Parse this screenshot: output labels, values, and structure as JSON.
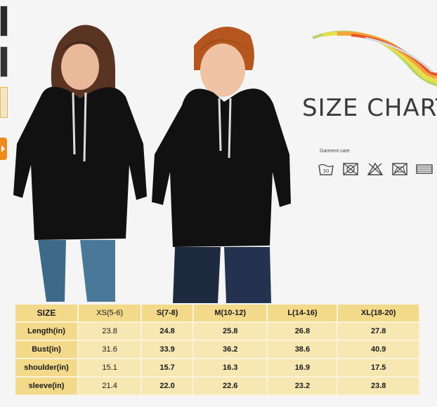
{
  "title": {
    "text": "SIZE CHART",
    "garment_care": "Garment care"
  },
  "care_icons": [
    "wash-30-icon",
    "no-bleach-icon",
    "no-tumble-dry-icon",
    "no-iron-icon",
    "flat-dry-icon"
  ],
  "wash_temp": "30",
  "colors": {
    "table_header": "#f3d98a",
    "table_body": "#f6e7b3",
    "accent_orange": "#f08a1c",
    "hoodie": "#111111"
  },
  "table": {
    "corner": "SIZE",
    "columns": [
      "XS(5-6)",
      "S(7-8)",
      "M(10-12)",
      "L(14-16)",
      "XL(18-20)"
    ],
    "rows": [
      {
        "label": "Length(in)",
        "values": [
          "23.8",
          "24.8",
          "25.8",
          "26.8",
          "27.8"
        ]
      },
      {
        "label": "Bust(in)",
        "values": [
          "31.6",
          "33.9",
          "36.2",
          "38.6",
          "40.9"
        ]
      },
      {
        "label": "shoulder(in)",
        "values": [
          "15.1",
          "15.7",
          "16.3",
          "16.9",
          "17.5"
        ]
      },
      {
        "label": "sleeve(in)",
        "values": [
          "21.4",
          "22.0",
          "22.6",
          "23.2",
          "23.8"
        ]
      }
    ]
  }
}
